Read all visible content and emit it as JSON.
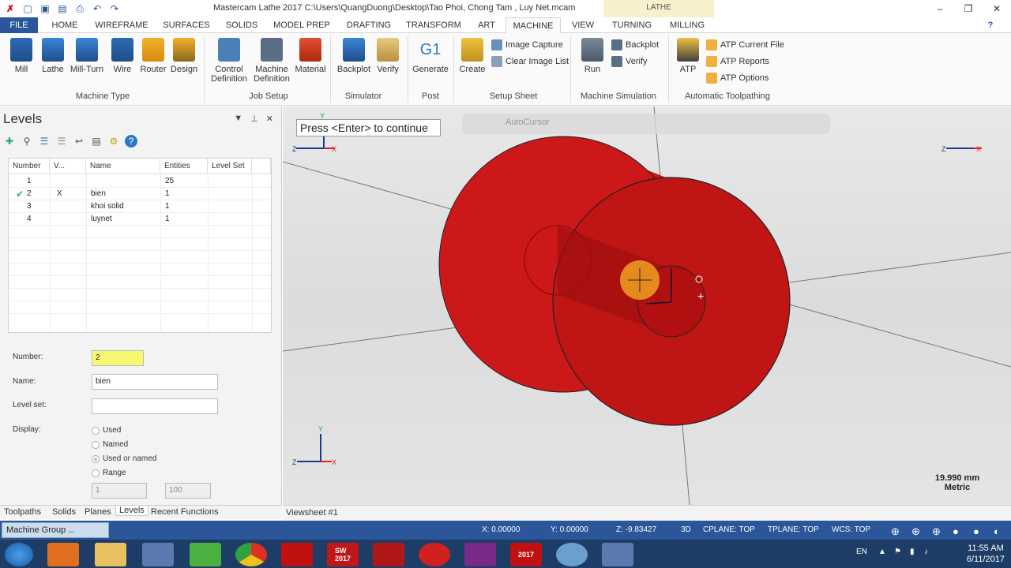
{
  "window": {
    "title": "Mastercam Lathe 2017  C:\\Users\\QuangDuong\\Desktop\\Tao Phoi, Chong Tam , Luy Net.mcam",
    "context_tab": "LATHE"
  },
  "tabs": [
    "FILE",
    "HOME",
    "WIREFRAME",
    "SURFACES",
    "SOLIDS",
    "MODEL PREP",
    "DRAFTING",
    "TRANSFORM",
    "ART",
    "MACHINE",
    "VIEW",
    "TURNING",
    "MILLING"
  ],
  "ribbon": {
    "machine_type": {
      "label": "Machine Type",
      "buttons": [
        "Mill",
        "Lathe",
        "Mill-Turn",
        "Wire",
        "Router",
        "Design"
      ]
    },
    "job_setup": {
      "label": "Job Setup",
      "buttons": [
        "Control\nDefinition",
        "Machine\nDefinition",
        "Material"
      ]
    },
    "simulator": {
      "label": "Simulator",
      "buttons": [
        "Backplot",
        "Verify"
      ]
    },
    "post": {
      "label": "Post",
      "buttons": [
        "Generate"
      ],
      "g1": "G1"
    },
    "setup_sheet": {
      "label": "Setup Sheet",
      "create": "Create",
      "image_capture": "Image Capture",
      "clear_image_list": "Clear Image List"
    },
    "machine_sim": {
      "label": "Machine Simulation",
      "run": "Run",
      "backplot": "Backplot",
      "verify": "Verify"
    },
    "auto_tp": {
      "label": "Automatic Toolpathing",
      "atp": "ATP",
      "current_file": "ATP Current File",
      "reports": "ATP Reports",
      "options": "ATP Options"
    }
  },
  "levels": {
    "title": "Levels",
    "columns": [
      "Number",
      "V...",
      "Name",
      "Entities",
      "Level Set"
    ],
    "rows": [
      {
        "number": "1",
        "v": "",
        "name": "",
        "entities": "25",
        "set": ""
      },
      {
        "number": "2",
        "v": "X",
        "name": "bien",
        "entities": "1",
        "set": ""
      },
      {
        "number": "3",
        "v": "",
        "name": "khoi solid",
        "entities": "1",
        "set": ""
      },
      {
        "number": "4",
        "v": "",
        "name": "luynet",
        "entities": "1",
        "set": ""
      }
    ],
    "number_label": "Number:",
    "number_value": "2",
    "name_label": "Name:",
    "name_value": "bien",
    "levelset_label": "Level set:",
    "levelset_value": "",
    "display_label": "Display:",
    "display_options": [
      "Used",
      "Named",
      "Used or named",
      "Range"
    ],
    "range_from": "1",
    "range_to": "100"
  },
  "bottom_tabs": [
    "Toolpaths",
    "Solids",
    "Planes",
    "Levels",
    "Recent Functions"
  ],
  "viewport": {
    "prompt": "Press <Enter> to continue",
    "autocursor": "AutoCursor",
    "scale": "19.990 mm",
    "scale_unit": "Metric",
    "viewsheet": "Viewsheet #1",
    "axis_x": "X",
    "axis_y": "Y",
    "axis_z": "Z"
  },
  "status": {
    "machine_group": "Machine Group ...",
    "x": "X:  0.00000",
    "y": "Y:  0.00000",
    "z": "Z:  -9.83427",
    "mode": "3D",
    "cplane": "CPLANE: TOP",
    "tplane": "TPLANE: TOP",
    "wcs": "WCS: TOP"
  },
  "taskbar": {
    "lang": "EN",
    "time": "11:55 AM",
    "date": "6/11/2017",
    "sw": "SW\n2017",
    "mc": "2017"
  },
  "colors": {
    "ribbon_blue": "#2b579a",
    "solid_red": "#c81414"
  }
}
